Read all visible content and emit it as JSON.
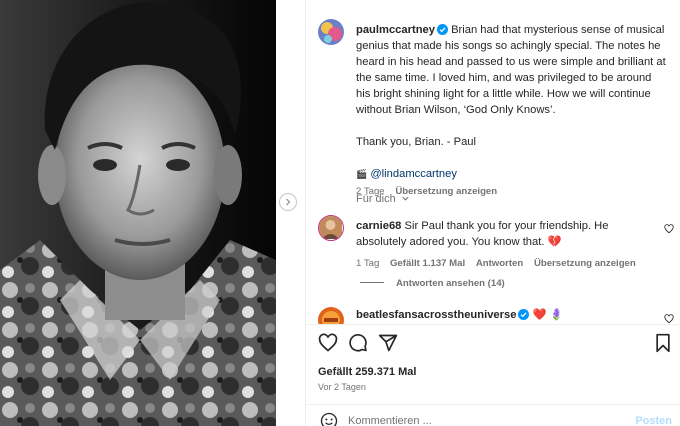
{
  "post": {
    "author": "paulmccartney",
    "caption": "Brian had that mysterious sense of musical genius that made his songs so achingly special. The notes he heard in his head and passed to us were simple and brilliant at the same time. I loved him, and was privileged to be around his bright shining light for a little while. How we will continue without Brian Wilson, ‘God Only Knows’.",
    "signoff": "Thank you, Brian. - Paul",
    "credit_emoji": "🎬",
    "credit_mention": "@lindamccartney",
    "age": "2 Tage",
    "translate": "Übersetzung anzeigen"
  },
  "for_you": "Für dich",
  "comments": [
    {
      "user": "carnie68",
      "text": "Sir Paul thank you for your friendship. He absolutely adored you. You know that. 💔",
      "age": "1 Tag",
      "likes": "Gefällt 1.137 Mal",
      "reply": "Antworten",
      "translate": "Übersetzung anzeigen",
      "view_replies": "Antworten ansehen (14)"
    },
    {
      "user": "beatlesfansacrosstheuniverse",
      "text": "❤️ 🪻"
    }
  ],
  "footer": {
    "likes": "Gefällt 259.371 Mal",
    "time": "Vor 2 Tagen",
    "comment_placeholder": "Kommentieren ...",
    "post_label": "Posten"
  },
  "colors": {
    "verified": "#0095f6",
    "mention": "#00376b",
    "secondary_text": "#737373"
  },
  "icons": [
    "heart-icon",
    "comment-icon",
    "share-icon",
    "bookmark-icon",
    "emoji-icon",
    "verified-badge-icon",
    "chevron-right-icon"
  ]
}
